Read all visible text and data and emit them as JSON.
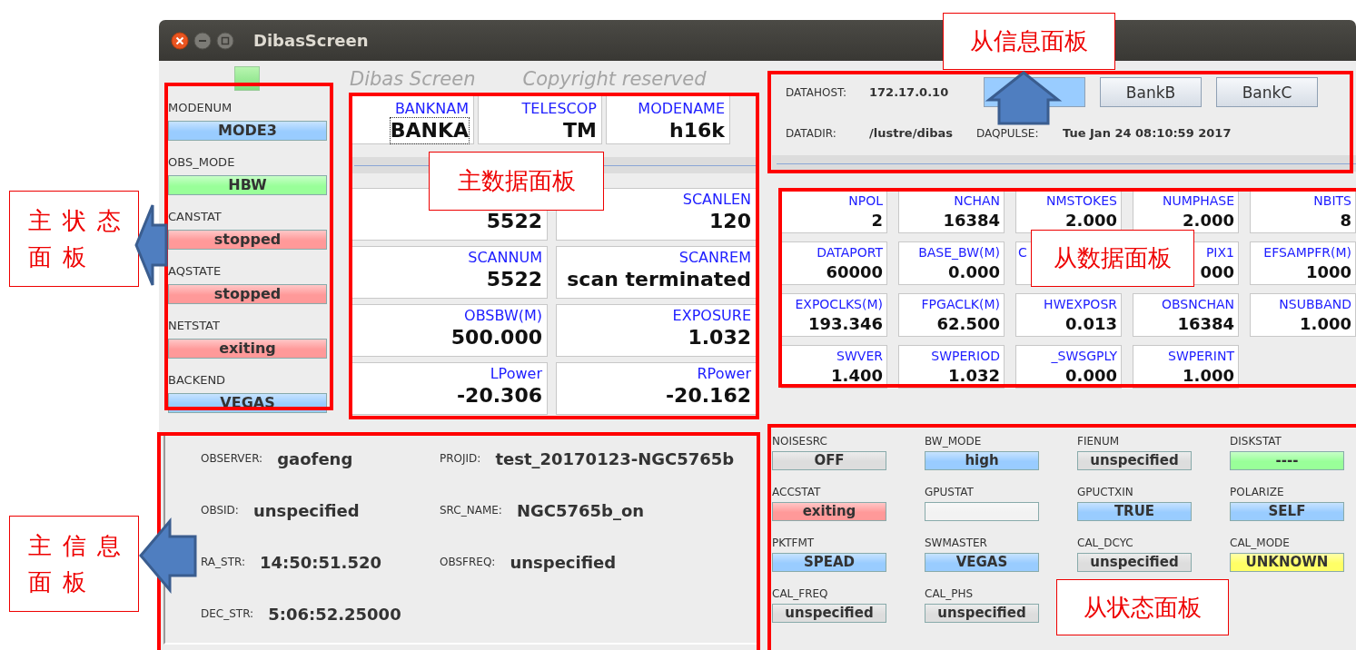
{
  "window": {
    "title": "DibasScreen"
  },
  "main_status": {
    "items": [
      {
        "label": "MODENUM",
        "value": "MODE3",
        "color": "#99ccff"
      },
      {
        "label": "OBS_MODE",
        "value": "HBW",
        "color": "#99ff99"
      },
      {
        "label": "CANSTAT",
        "value": "stopped",
        "color": "#ff9999"
      },
      {
        "label": "AQSTATE",
        "value": "stopped",
        "color": "#ff9999"
      },
      {
        "label": "NETSTAT",
        "value": "exiting",
        "color": "#ff9999"
      },
      {
        "label": "BACKEND",
        "value": "VEGAS",
        "color": "#99ccff"
      }
    ]
  },
  "main_data": {
    "header": [
      "Dibas Screen",
      "Copyright reserved"
    ],
    "top_cells": [
      {
        "label": "BANKNAM",
        "value": "BANKA",
        "focused": true
      },
      {
        "label": "TELESCOP",
        "value": "TM",
        "focused": false
      },
      {
        "label": "MODENAME",
        "value": "h16k",
        "focused": false
      }
    ],
    "first_cell": {
      "value": "5522"
    },
    "cells": [
      {
        "label": "SCANLEN",
        "value": "120"
      },
      {
        "label": "SCANNUM",
        "value": "5522"
      },
      {
        "label": "SCANREM",
        "value": "scan terminated"
      },
      {
        "label": "OBSBW(M)",
        "value": "500.000"
      },
      {
        "label": "EXPOSURE",
        "value": "1.032"
      },
      {
        "label": "LPower",
        "value": "-20.306"
      },
      {
        "label": "RPower",
        "value": "-20.162"
      }
    ]
  },
  "slave_info": {
    "host": {
      "label": "DATAHOST:",
      "value": "172.17.0.10"
    },
    "banks": [
      {
        "selected": true
      },
      {
        "label": "BankB",
        "selected": false
      },
      {
        "label": "BankC",
        "selected": false
      }
    ],
    "dir": {
      "label": "DATADIR:",
      "value": "/lustre/dibas"
    },
    "pulse": {
      "label": "DAQPULSE:",
      "value": "Tue Jan 24 08:10:59 2017"
    }
  },
  "slave_data": {
    "cells": [
      {
        "label": "NPOL",
        "value": "2"
      },
      {
        "label": "NCHAN",
        "value": "16384"
      },
      {
        "label": "NMSTOKES",
        "value": "2.000"
      },
      {
        "label": "NUMPHASE",
        "value": "2.000"
      },
      {
        "label": "NBITS",
        "value": "8"
      },
      {
        "label": "DATAPORT",
        "value": "60000"
      },
      {
        "label": "BASE_BW(M)",
        "value": "0.000"
      },
      {
        "label": "C",
        "cut": true
      },
      {
        "label": "PIX1",
        "value": "000"
      },
      {
        "label": "EFSAMPFR(M)",
        "value": "1000"
      },
      {
        "label": "EXPOCLKS(M)",
        "value": "193.346"
      },
      {
        "label": "FPGACLK(M)",
        "value": "62.500"
      },
      {
        "label": "HWEXPOSR",
        "value": "0.013"
      },
      {
        "label": "OBSNCHAN",
        "value": "16384"
      },
      {
        "label": "NSUBBAND",
        "value": "1.000"
      },
      {
        "label": "SWVER",
        "value": "1.400"
      },
      {
        "label": "SWPERIOD",
        "value": "1.032"
      },
      {
        "label": "_SWSGPLY",
        "value": "0.000"
      },
      {
        "label": "SWPERINT",
        "value": "1.000"
      }
    ]
  },
  "main_info": {
    "fields": [
      {
        "label": "OBSERVER:",
        "value": "gaofeng"
      },
      {
        "label": "PROJID:",
        "value": "test_20170123-NGC5765b"
      },
      {
        "label": "OBSID:",
        "value": "unspecified"
      },
      {
        "label": "SRC_NAME:",
        "value": "NGC5765b_on"
      },
      {
        "label": "RA_STR:",
        "value": "14:50:51.520"
      },
      {
        "label": "OBSFREQ:",
        "value": "unspecified"
      },
      {
        "label": "DEC_STR:",
        "value": "5:06:52.25000"
      }
    ]
  },
  "slave_status": {
    "items": [
      {
        "label": "NOISESRC",
        "value": "OFF",
        "color": "#dddddd"
      },
      {
        "label": "BW_MODE",
        "value": "high",
        "color": "#99ccff"
      },
      {
        "label": "FIENUM",
        "value": "unspecified",
        "color": "#dddddd"
      },
      {
        "label": "DISKSTAT",
        "value": "----",
        "color": "#99ff99"
      },
      {
        "label": "ACCSTAT",
        "value": "exiting",
        "color": "#ff9999"
      },
      {
        "label": "GPUSTAT",
        "color": "#f2f2f2"
      },
      {
        "label": "GPUCTXIN",
        "value": "TRUE",
        "color": "#99ccff"
      },
      {
        "label": "POLARIZE",
        "value": "SELF",
        "color": "#99ccff"
      },
      {
        "label": "PKTFMT",
        "value": "SPEAD",
        "color": "#99ccff"
      },
      {
        "label": "SWMASTER",
        "value": "VEGAS",
        "color": "#99ccff"
      },
      {
        "label": "CAL_DCYC",
        "value": "unspecified",
        "color": "#dddddd"
      },
      {
        "label": "CAL_MODE",
        "value": "UNKNOWN",
        "color": "#ffff66"
      },
      {
        "label": "CAL_FREQ",
        "value": "unspecified",
        "color": "#dddddd"
      },
      {
        "label": "CAL_PHS",
        "value": "unspecified",
        "color": "#dddddd"
      }
    ]
  },
  "annotations": [
    {
      "text": "主状态面板"
    },
    {
      "text": "主信息面板"
    },
    {
      "text": "主数据面板"
    },
    {
      "text": "从信息面板"
    },
    {
      "text": "从数据面板"
    },
    {
      "text": "从状态面板"
    }
  ]
}
